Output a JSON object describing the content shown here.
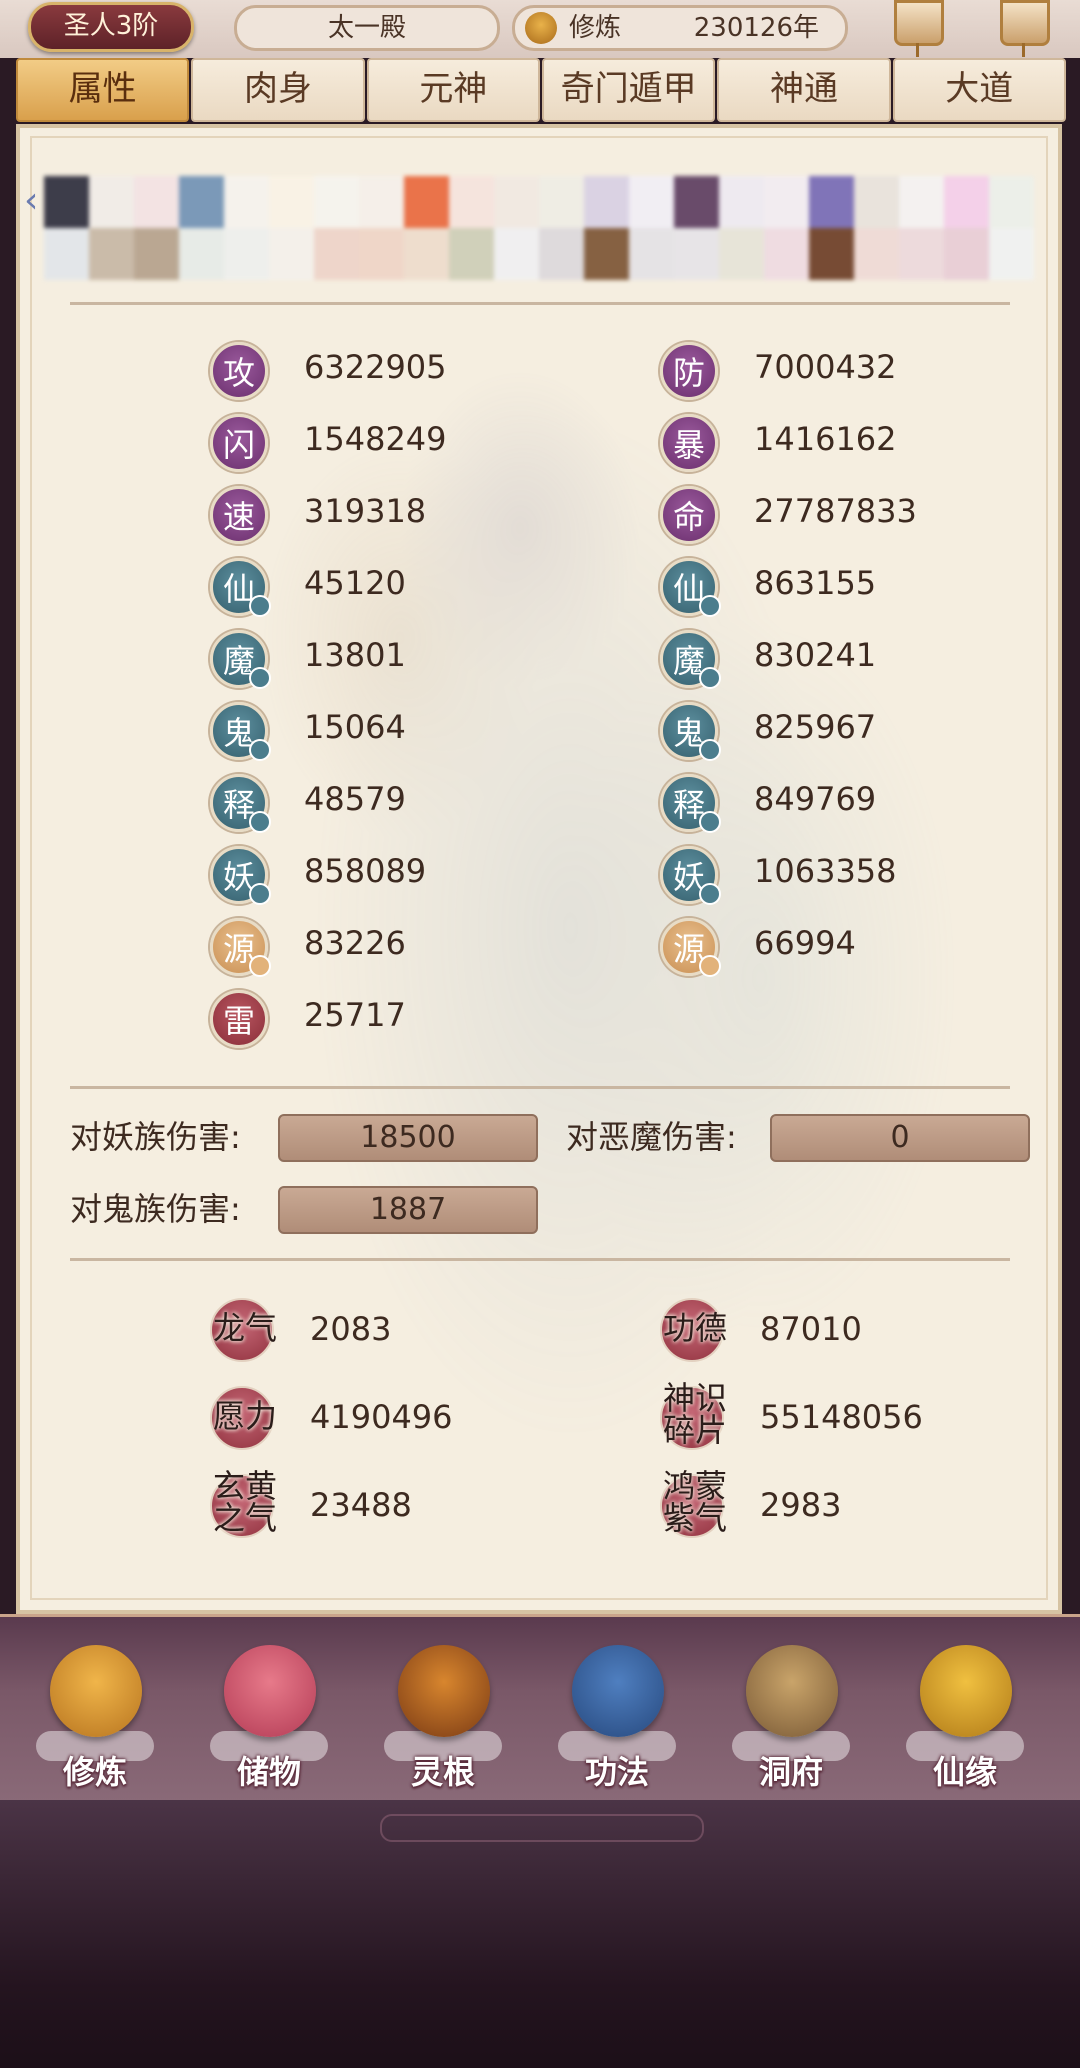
{
  "topbar": {
    "rank": "圣人3阶",
    "location": "太一殿",
    "cultivate_label": "修炼",
    "cultivate_value": "230126年"
  },
  "tabs": [
    "属性",
    "肉身",
    "元神",
    "奇门遁甲",
    "神通",
    "大道"
  ],
  "active_tab": "属性",
  "stats_left": [
    {
      "glyph": "攻",
      "value": "6322905",
      "style": "purple"
    },
    {
      "glyph": "闪",
      "value": "1548249",
      "style": "purple"
    },
    {
      "glyph": "速",
      "value": "319318",
      "style": "purple"
    },
    {
      "glyph": "仙",
      "value": "45120",
      "style": "teal"
    },
    {
      "glyph": "魔",
      "value": "13801",
      "style": "teal"
    },
    {
      "glyph": "鬼",
      "value": "15064",
      "style": "teal"
    },
    {
      "glyph": "释",
      "value": "48579",
      "style": "teal"
    },
    {
      "glyph": "妖",
      "value": "858089",
      "style": "teal"
    },
    {
      "glyph": "源",
      "value": "83226",
      "style": "gold"
    },
    {
      "glyph": "雷",
      "value": "25717",
      "style": "red"
    }
  ],
  "stats_right": [
    {
      "glyph": "防",
      "value": "7000432",
      "style": "purple"
    },
    {
      "glyph": "暴",
      "value": "1416162",
      "style": "purple"
    },
    {
      "glyph": "命",
      "value": "27787833",
      "style": "purple"
    },
    {
      "glyph": "仙",
      "value": "863155",
      "style": "teal"
    },
    {
      "glyph": "魔",
      "value": "830241",
      "style": "teal"
    },
    {
      "glyph": "鬼",
      "value": "825967",
      "style": "teal"
    },
    {
      "glyph": "释",
      "value": "849769",
      "style": "teal"
    },
    {
      "glyph": "妖",
      "value": "1063358",
      "style": "teal"
    },
    {
      "glyph": "源",
      "value": "66994",
      "style": "gold"
    }
  ],
  "damage": {
    "yao_label": "对妖族伤害:",
    "yao_value": "18500",
    "demon_label": "对恶魔伤害:",
    "demon_value": "0",
    "ghost_label": "对鬼族伤害:",
    "ghost_value": "1887"
  },
  "resources": [
    {
      "label": "龙气",
      "value": "2083"
    },
    {
      "label": "功德",
      "value": "87010"
    },
    {
      "label": "愿力",
      "value": "4190496"
    },
    {
      "label": "神识碎片",
      "value": "55148056"
    },
    {
      "label": "玄黄之气",
      "value": "23488"
    },
    {
      "label": "鸿蒙紫气",
      "value": "2983"
    }
  ],
  "bottom_nav": [
    "修炼",
    "储物",
    "灵根",
    "功法",
    "洞府",
    "仙缘"
  ],
  "strip_colors": [
    "#2a2a3a",
    "#f1ece8",
    "#f3e2e4",
    "#6e90b4",
    "#f6f3ee",
    "#faf3e6",
    "#f6f4ef",
    "#f5f0ea",
    "#e9663a",
    "#f6e3dd",
    "#f1e9e2",
    "#efede5",
    "#d8d0e4",
    "#f1eef6",
    "#5a3a5e",
    "#eeeaf2",
    "#f2ecf2",
    "#7467b4",
    "#e8e2dc",
    "#f4f2f2",
    "#f4cdea",
    "#ecf0ea",
    "#e2e6ea",
    "#c6b6a4",
    "#b4a08a",
    "#e6ebe8",
    "#eef0ee",
    "#f4f1ec",
    "#eed3c8",
    "#efd4c6",
    "#eedccc",
    "#cdcdb6",
    "#f0f0f2",
    "#dcd8dc",
    "#7a5232",
    "#e4e2e6",
    "#e6e4e8",
    "#e6e4d8",
    "#efdbe2",
    "#6a3a22",
    "#efdad6",
    "#edd8dc",
    "#e8ccd6",
    "#f0f2f2"
  ]
}
